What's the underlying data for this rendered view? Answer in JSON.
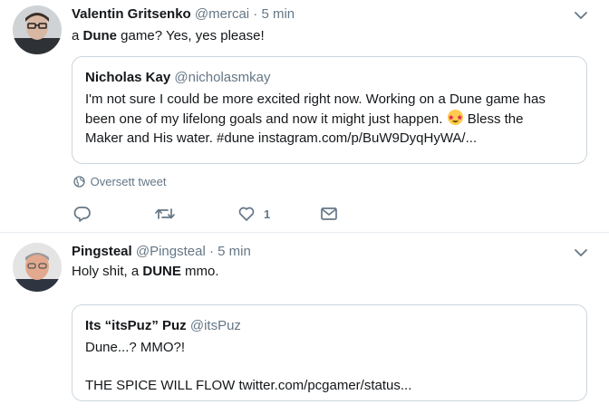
{
  "tweets": [
    {
      "name": "Valentin Gritsenko",
      "handle": "@mercai",
      "separator": "·",
      "time": "5 min",
      "text_parts": [
        "a ",
        "Dune",
        " game? Yes, yes please!"
      ],
      "quote": {
        "name": "Nicholas Kay",
        "handle": "@nicholasmkay",
        "lines": [
          "I'm not sure I could be more excited right now. Working on a Dune game has",
          "been one of my lifelong goals and now it might just happen.",
          " Bless the",
          "Maker and His water. #dune instagram.com/p/BuW9DyqHyWA/..."
        ]
      },
      "translate_label": "Oversett tweet",
      "like_count": "1"
    },
    {
      "name": "Pingsteal",
      "handle": "@Pingsteal",
      "separator": "·",
      "time": "5 min",
      "text_parts": [
        "Holy shit, a ",
        "DUNE",
        " mmo."
      ],
      "quote": {
        "name": "Its “itsPuz” Puz",
        "handle": "@itsPuz",
        "lines": [
          "Dune...? MMO?!",
          "THE SPICE WILL FLOW twitter.com/pcgamer/status..."
        ]
      }
    }
  ],
  "icons": {
    "reply": "reply-icon",
    "retweet": "retweet-icon",
    "like": "heart-icon",
    "dm": "envelope-icon",
    "globe": "globe-icon",
    "chevron": "chevron-down-icon",
    "emoji": "star-struck-emoji"
  },
  "colors": {
    "text": "#14171a",
    "secondary": "#657786",
    "border": "#ccd6dd",
    "divider": "#e6ecf0"
  }
}
